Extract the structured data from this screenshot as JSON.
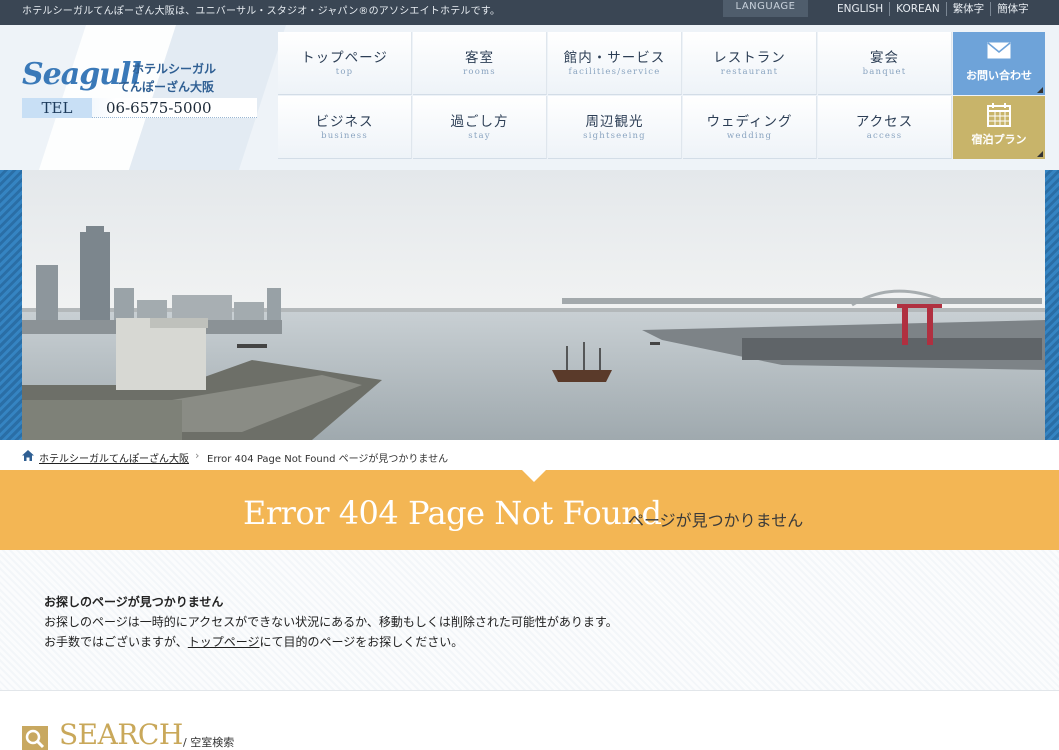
{
  "topbar": {
    "tagline": "ホテルシーガルてんぽーざん大阪は、ユニバーサル・スタジオ・ジャパン®のアソシエイトホテルです。",
    "language_label": "LANGUAGE",
    "languages": [
      "ENGLISH",
      "KOREAN",
      "繁体字",
      "簡体字"
    ]
  },
  "header": {
    "logo_word": "Seagull",
    "logo_jp_line1": "ホテルシーガル",
    "logo_jp_line2": "てんぽーざん大阪",
    "tel_label": "TEL",
    "tel_number": "06-6575-5000"
  },
  "nav": {
    "items": [
      {
        "jp": "トップページ",
        "en": "top"
      },
      {
        "jp": "客室",
        "en": "rooms"
      },
      {
        "jp": "館内・サービス",
        "en": "facilities/service"
      },
      {
        "jp": "レストラン",
        "en": "restaurant"
      },
      {
        "jp": "宴会",
        "en": "banquet"
      },
      {
        "jp": "ビジネス",
        "en": "business"
      },
      {
        "jp": "過ごし方",
        "en": "stay"
      },
      {
        "jp": "周辺観光",
        "en": "sightseeing"
      },
      {
        "jp": "ウェディング",
        "en": "wedding"
      },
      {
        "jp": "アクセス",
        "en": "access"
      }
    ],
    "contact_label": "お問い合わせ",
    "plan_label": "宿泊プラン"
  },
  "breadcrumb": {
    "home": "ホテルシーガルてんぽーざん大阪",
    "current": "Error 404 Page Not Found ページが見つかりません"
  },
  "banner": {
    "title_en": "Error 404 Page Not Found",
    "title_jp": "ページが見つかりません"
  },
  "content": {
    "heading": "お探しのページが見つかりません",
    "line1": "お探しのページは一時的にアクセスができない状況にあるか、移動もしくは削除された可能性があります。",
    "line2_before": "お手数ではございますが、",
    "line2_link": "トップページ",
    "line2_after": "にて目的のページをお探しください。"
  },
  "search": {
    "title": "SEARCH",
    "subtitle": "/ 空室検索"
  },
  "colors": {
    "topbar": "#3a4654",
    "accent_blue": "#6ea3d9",
    "accent_gold": "#c8b46a",
    "banner_orange": "#f3b654"
  },
  "icons": {
    "contact": "mail-icon",
    "plan": "calendar-icon",
    "home": "home-icon",
    "search": "search-icon"
  }
}
